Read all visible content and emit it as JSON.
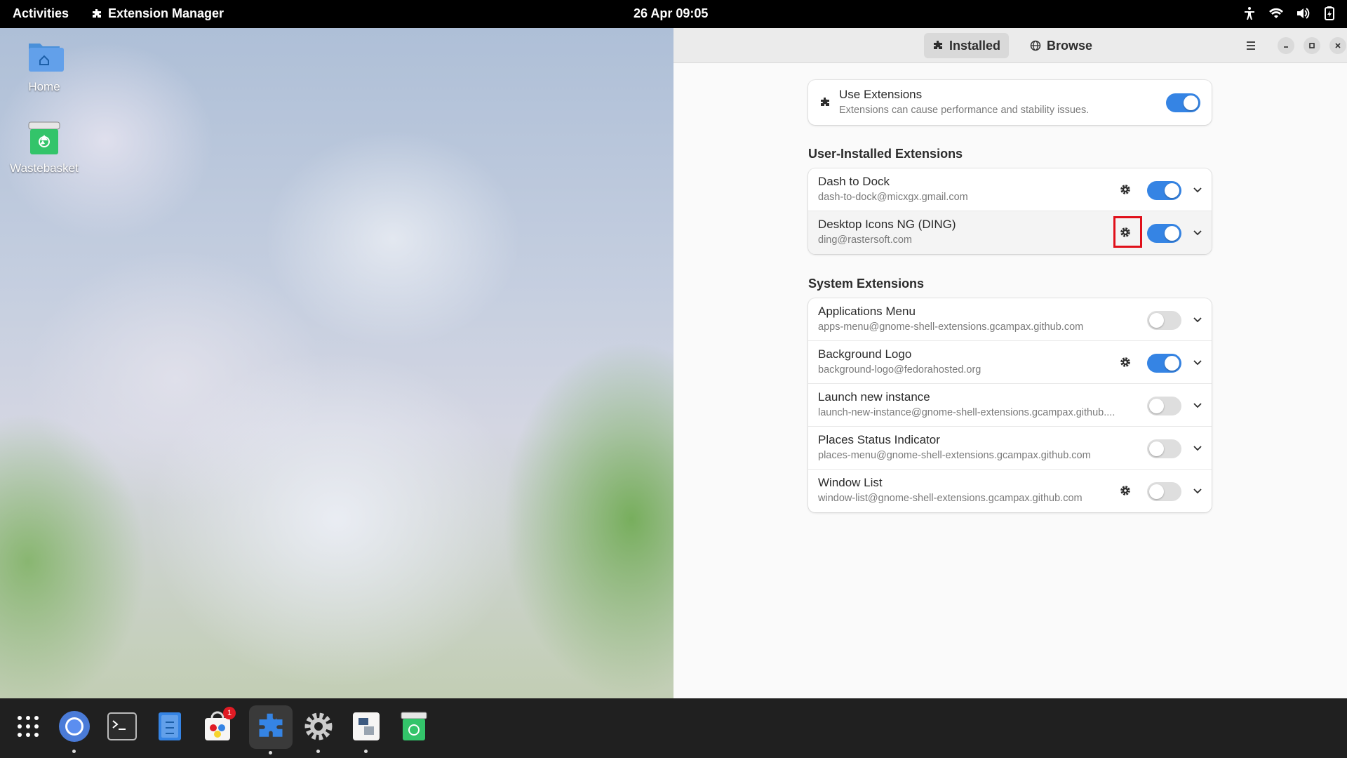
{
  "topbar": {
    "activities": "Activities",
    "app_name": "Extension Manager",
    "clock": "26 Apr  09:05"
  },
  "desktop": {
    "icons": [
      {
        "label": "Home",
        "icon": "home-folder-icon"
      },
      {
        "label": "Wastebasket",
        "icon": "trash-icon"
      }
    ]
  },
  "window": {
    "tabs": [
      {
        "label": "Installed",
        "icon": "puzzle-icon",
        "active": true
      },
      {
        "label": "Browse",
        "icon": "globe-icon",
        "active": false
      }
    ],
    "use_extensions": {
      "title": "Use Extensions",
      "subtitle": "Extensions can cause performance and stability issues.",
      "enabled": true
    },
    "user_section_title": "User-Installed Extensions",
    "user_extensions": [
      {
        "name": "Dash to Dock",
        "id": "dash-to-dock@micxgx.gmail.com",
        "has_settings": true,
        "enabled": true
      },
      {
        "name": "Desktop Icons NG (DING)",
        "id": "ding@rastersoft.com",
        "has_settings": true,
        "enabled": true
      }
    ],
    "system_section_title": "System Extensions",
    "system_extensions": [
      {
        "name": "Applications Menu",
        "id": "apps-menu@gnome-shell-extensions.gcampax.github.com",
        "has_settings": false,
        "enabled": false
      },
      {
        "name": "Background Logo",
        "id": "background-logo@fedorahosted.org",
        "has_settings": true,
        "enabled": true
      },
      {
        "name": "Launch new instance",
        "id": "launch-new-instance@gnome-shell-extensions.gcampax.github....",
        "has_settings": false,
        "enabled": false
      },
      {
        "name": "Places Status Indicator",
        "id": "places-menu@gnome-shell-extensions.gcampax.github.com",
        "has_settings": false,
        "enabled": false
      },
      {
        "name": "Window List",
        "id": "window-list@gnome-shell-extensions.gcampax.github.com",
        "has_settings": true,
        "enabled": false
      }
    ]
  },
  "dock": {
    "software_badge": "1",
    "items": [
      "app-grid-icon",
      "chromium-icon",
      "terminal-icon",
      "files-icon",
      "software-center-icon",
      "extension-manager-icon",
      "settings-icon",
      "text-editor-icon",
      "trash-icon"
    ]
  },
  "colors": {
    "accent": "#3584e4",
    "highlight": "#e0101a"
  }
}
